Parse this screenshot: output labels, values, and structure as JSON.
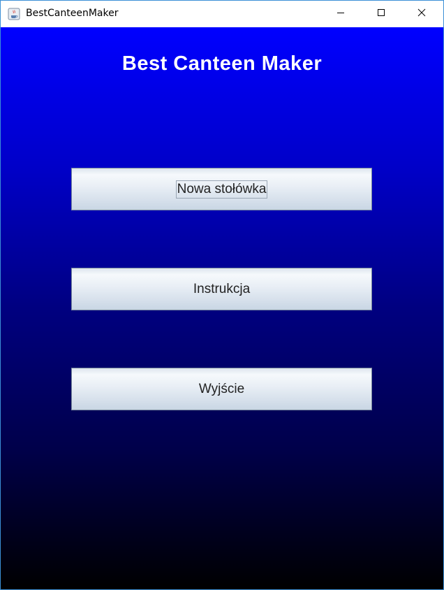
{
  "window": {
    "title": "BestCanteenMaker",
    "controls": {
      "minimize": "minimize-icon",
      "maximize": "maximize-icon",
      "close": "close-icon"
    },
    "border_color": "#3c8fd6"
  },
  "main": {
    "heading": "Best Canteen Maker",
    "buttons": [
      {
        "label": "Nowa stołówka",
        "focused": true
      },
      {
        "label": "Instrukcja",
        "focused": false
      },
      {
        "label": "Wyjście",
        "focused": false
      }
    ],
    "background_gradient": [
      "#0000ff",
      "#000000"
    ],
    "heading_color": "#ffffff"
  }
}
